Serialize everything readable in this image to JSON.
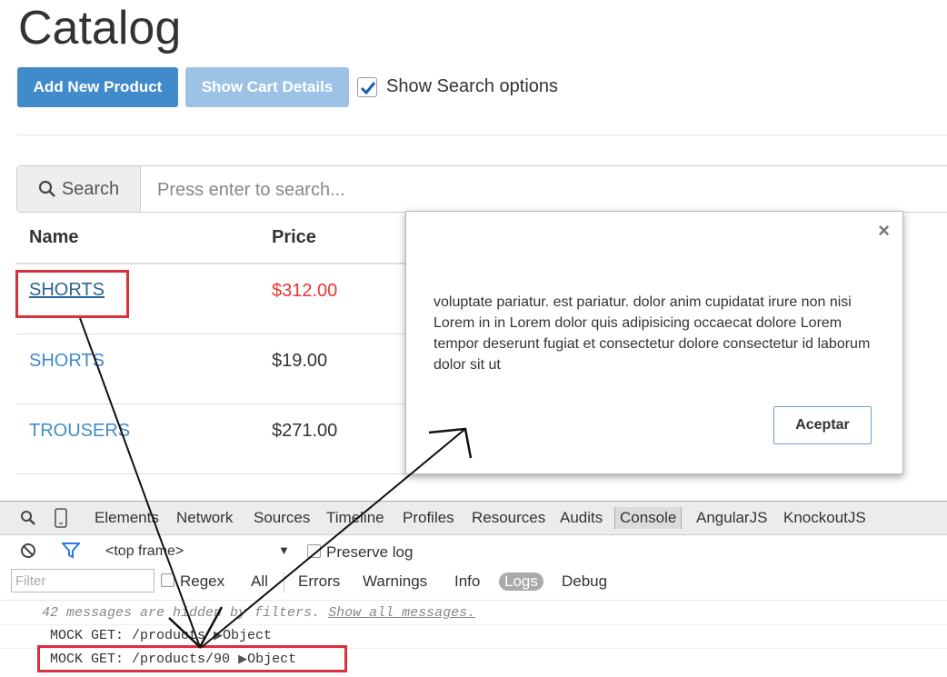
{
  "page": {
    "title": "Catalog",
    "buttons": {
      "add_new_product": "Add New Product",
      "show_cart_details": "Show Cart Details"
    },
    "show_search_options": {
      "label": "Show Search options",
      "checked": true
    },
    "search": {
      "addon_label": "Search",
      "placeholder": "Press enter to search..."
    },
    "table": {
      "headers": [
        "Name",
        "Price"
      ],
      "rows": [
        {
          "name": "SHORTS",
          "price": "$312.00"
        },
        {
          "name": "SHORTS",
          "price": "$19.00"
        },
        {
          "name": "TROUSERS",
          "price": "$271.00"
        }
      ]
    }
  },
  "modal": {
    "close_symbol": "×",
    "body_text": "voluptate pariatur. est pariatur. dolor anim cupidatat irure non nisi Lorem in in Lorem dolor quis adipisicing occaecat dolore Lorem tempor deserunt fugiat et consectetur dolore consectetur id laborum dolor sit ut",
    "button_label": "Aceptar"
  },
  "devtools": {
    "tabs": [
      "Elements",
      "Network",
      "Sources",
      "Timeline",
      "Profiles",
      "Resources",
      "Audits",
      "Console",
      "AngularJS",
      "KnockoutJS"
    ],
    "active_tab": "Console",
    "frame_selector": "<top frame>",
    "preserve_log_label": "Preserve log",
    "filter_placeholder": "Filter",
    "regex_label": "Regex",
    "levels": [
      "All",
      "Errors",
      "Warnings",
      "Info",
      "Logs",
      "Debug"
    ],
    "active_level": "Logs",
    "console": {
      "hidden_message_prefix": "42 messages are hidden by filters.",
      "show_all_link": "Show all messages.",
      "lines": [
        {
          "text": "MOCK GET: /products",
          "object": "Object"
        },
        {
          "text": "MOCK GET: /products/90",
          "object": "Object"
        }
      ]
    }
  },
  "colors": {
    "primary": "#428bca",
    "primary_light": "#9cc3e6",
    "highlight_red": "#d9303b",
    "price_red": "#ee3333"
  }
}
